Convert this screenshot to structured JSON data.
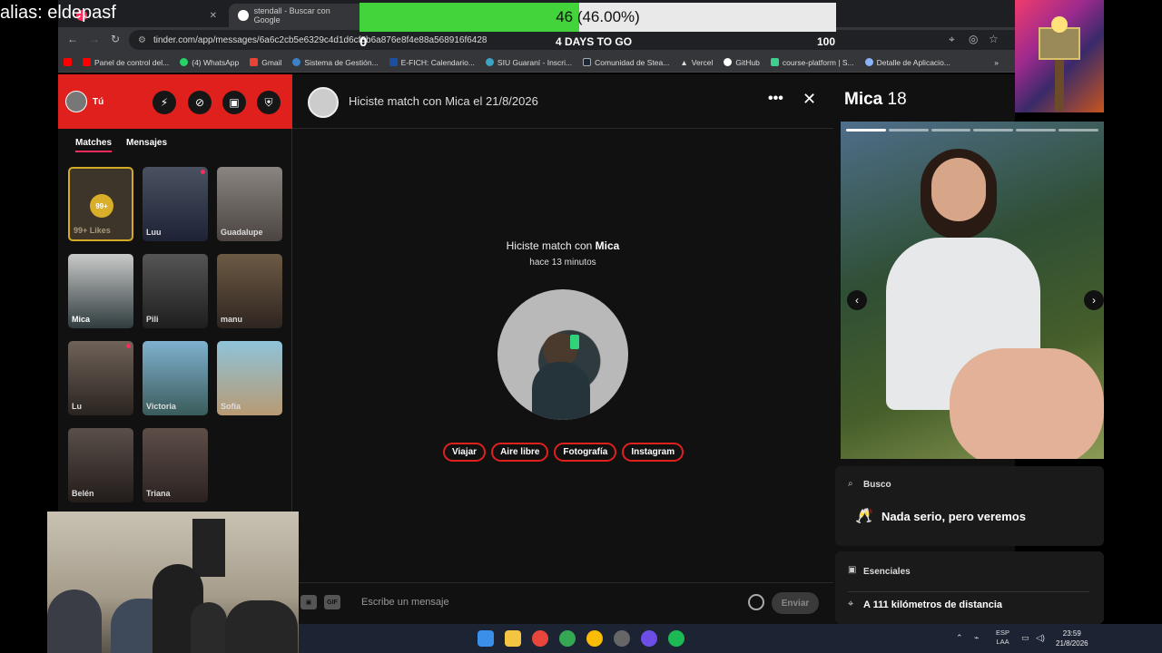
{
  "overlay": {
    "alias": "alias: eldepasf",
    "progress_text": "46 (46.00%)",
    "progress_fraction": 0.46,
    "goal_start": "0",
    "goal_end": "100",
    "days_left": "4 DAYS TO GO"
  },
  "browser": {
    "tabs": [
      {
        "title": "stendall - Buscar con Google"
      }
    ],
    "url": "tinder.com/app/messages/6a6c2cb5e6329c4d1d6cf8b6a876e8f4e88a568916f6428",
    "bookmarks": [
      "Panel de control del...",
      "(4) WhatsApp",
      "Gmail",
      "Sistema de Gestión...",
      "E-FICH: Calendario...",
      "SIU Guaraní - Inscri...",
      "Comunidad de Stea...",
      "Vercel",
      "GitHub",
      "course-platform | S...",
      "Detalle de Aplicacio..."
    ]
  },
  "sidebar": {
    "user_label": "Tú",
    "tabs": [
      "Matches",
      "Mensajes"
    ],
    "likes_badge": "99+",
    "likes_label": "99+ Likes",
    "matches": [
      "Luu",
      "Guadalupe",
      "Mica",
      "Pili",
      "manu",
      "Lu",
      "Victoria",
      "Sofia",
      "Belén",
      "Triana"
    ]
  },
  "chat": {
    "header": "Hiciste match con Mica el 21/8/2026",
    "match_prefix": "Hiciste match con",
    "match_name": "Mica",
    "time_ago": "hace 13 minutos",
    "interests": [
      "Viajar",
      "Aire libre",
      "Fotografía",
      "Instagram"
    ],
    "gif_label": "GIF",
    "input_placeholder": "Escribe un mensaje",
    "send_label": "Enviar"
  },
  "profile": {
    "name": "Mica",
    "age": "18",
    "looking_label": "Busco",
    "looking_value": "Nada serio, pero veremos",
    "essentials_label": "Esenciales",
    "distance": "A 111 kilómetros de distancia"
  },
  "taskbar": {
    "lang_line1": "ESP",
    "lang_line2": "LAA",
    "time": "23:59",
    "date": "21/8/2026"
  },
  "colors": {
    "brand": "#e0201d",
    "progress": "#42d43a",
    "accent": "#fd2c5d"
  }
}
